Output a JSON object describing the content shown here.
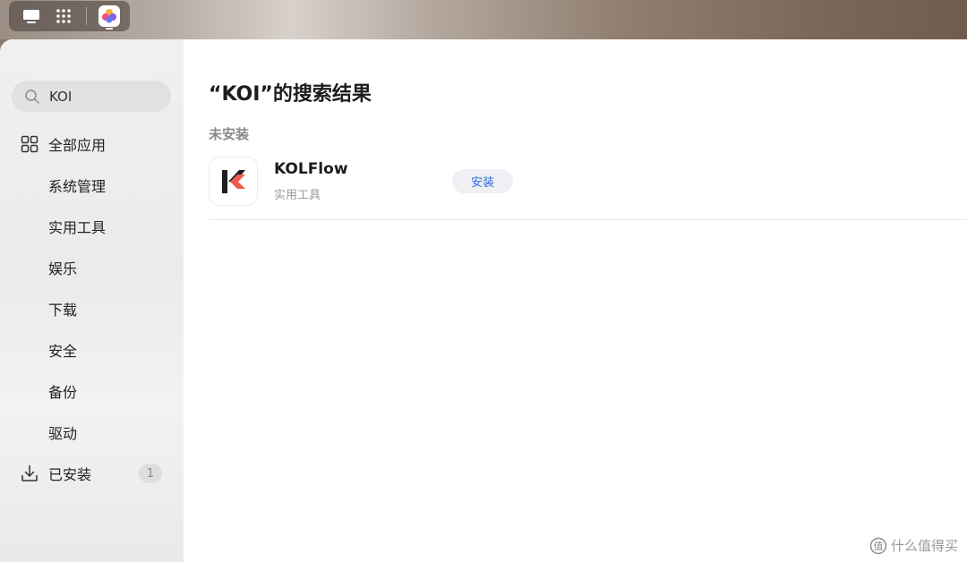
{
  "search": {
    "value": "KOI"
  },
  "sidebar": {
    "items": [
      {
        "label": "全部应用",
        "icon": "grid-icon"
      },
      {
        "label": "系统管理"
      },
      {
        "label": "实用工具"
      },
      {
        "label": "娱乐"
      },
      {
        "label": "下载"
      },
      {
        "label": "安全"
      },
      {
        "label": "备份"
      },
      {
        "label": "驱动"
      },
      {
        "label": "已安装",
        "icon": "download-icon",
        "count": "1"
      }
    ]
  },
  "main": {
    "title": "“KOI”的搜索结果",
    "section_label": "未安装",
    "results": [
      {
        "name": "KOLFlow",
        "category": "实用工具",
        "action": "安装"
      }
    ]
  },
  "watermark": {
    "text": "什么值得买"
  },
  "colors": {
    "accent": "#2f6bdc",
    "logo_dark": "#1e1e1e",
    "logo_red": "#ee5a4f"
  }
}
